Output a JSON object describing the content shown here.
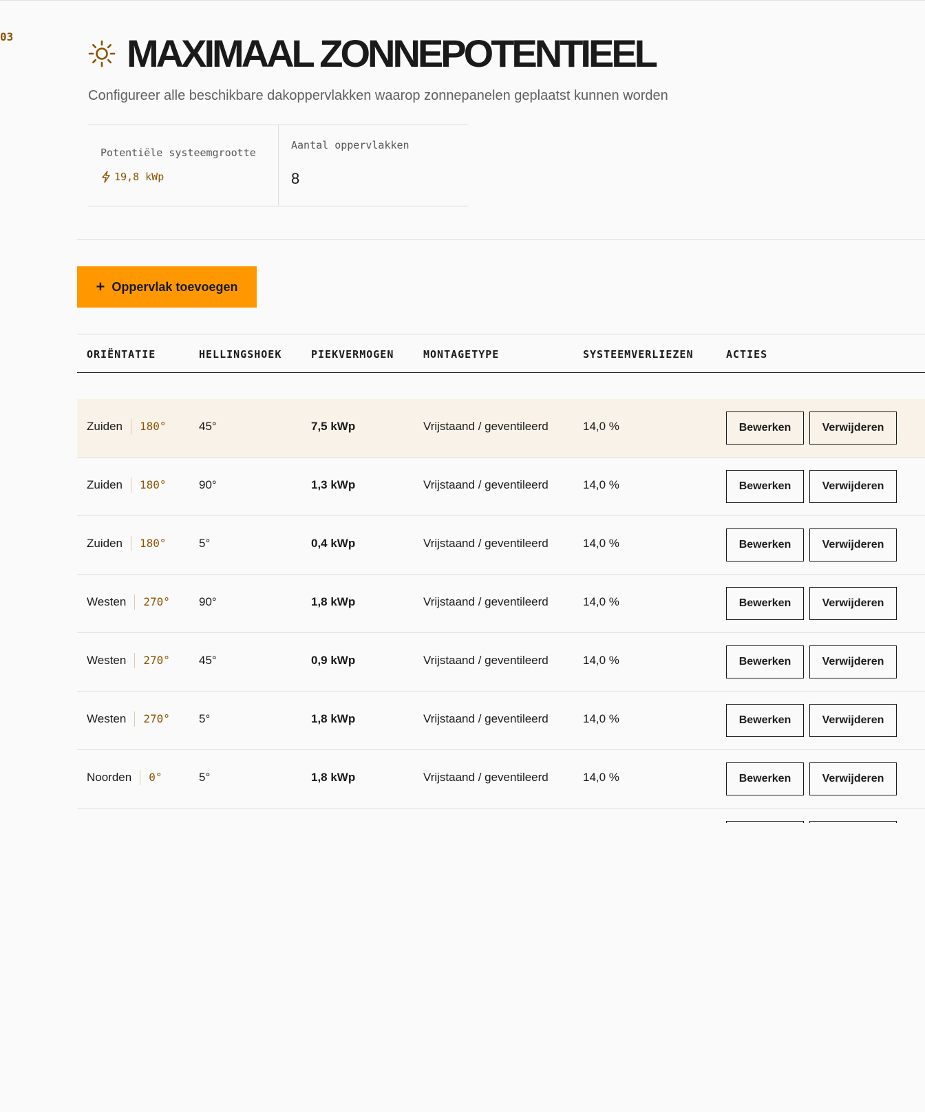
{
  "step_number": "03",
  "header": {
    "title": "MAXIMAAL ZONNEPOTENTIEEL",
    "subtitle": "Configureer alle beschikbare dakoppervlakken waarop zonnepanelen geplaatst kunnen worden",
    "icon": "sun-icon"
  },
  "stats": {
    "system_size": {
      "label": "Potentiële systeemgrootte",
      "value": "19,8 kWp",
      "icon": "lightning-icon"
    },
    "surface_count": {
      "label": "Aantal oppervlakken",
      "value": "8"
    }
  },
  "add_button": {
    "label": "Oppervlak toevoegen",
    "icon": "plus-icon"
  },
  "table": {
    "columns": [
      "ORIËNTATIE",
      "HELLINGSHOEK",
      "PIEKVERMOGEN",
      "MONTAGETYPE",
      "SYSTEEMVERLIEZEN",
      "ACTIES"
    ],
    "edit_label": "Bewerken",
    "delete_label": "Verwijderen",
    "rows": [
      {
        "orientation": "Zuiden",
        "azimuth": "180°",
        "tilt": "45°",
        "peak": "7,5 kWp",
        "mount": "Vrijstaand / geventileerd",
        "loss": "14,0 %"
      },
      {
        "orientation": "Zuiden",
        "azimuth": "180°",
        "tilt": "90°",
        "peak": "1,3 kWp",
        "mount": "Vrijstaand / geventileerd",
        "loss": "14,0 %"
      },
      {
        "orientation": "Zuiden",
        "azimuth": "180°",
        "tilt": "5°",
        "peak": "0,4 kWp",
        "mount": "Vrijstaand / geventileerd",
        "loss": "14,0 %"
      },
      {
        "orientation": "Westen",
        "azimuth": "270°",
        "tilt": "90°",
        "peak": "1,8 kWp",
        "mount": "Vrijstaand / geventileerd",
        "loss": "14,0 %"
      },
      {
        "orientation": "Westen",
        "azimuth": "270°",
        "tilt": "45°",
        "peak": "0,9 kWp",
        "mount": "Vrijstaand / geventileerd",
        "loss": "14,0 %"
      },
      {
        "orientation": "Westen",
        "azimuth": "270°",
        "tilt": "5°",
        "peak": "1,8 kWp",
        "mount": "Vrijstaand / geventileerd",
        "loss": "14,0 %"
      },
      {
        "orientation": "Noorden",
        "azimuth": "0°",
        "tilt": "5°",
        "peak": "1,8 kWp",
        "mount": "Vrijstaand / geventileerd",
        "loss": "14,0 %"
      },
      {
        "orientation": "",
        "azimuth": "",
        "tilt": "",
        "peak": "",
        "mount": "",
        "loss": ""
      }
    ]
  },
  "colors": {
    "accent": "#ff9800",
    "accent_text": "#8a5300",
    "highlight_row": "#f8f2e8"
  }
}
